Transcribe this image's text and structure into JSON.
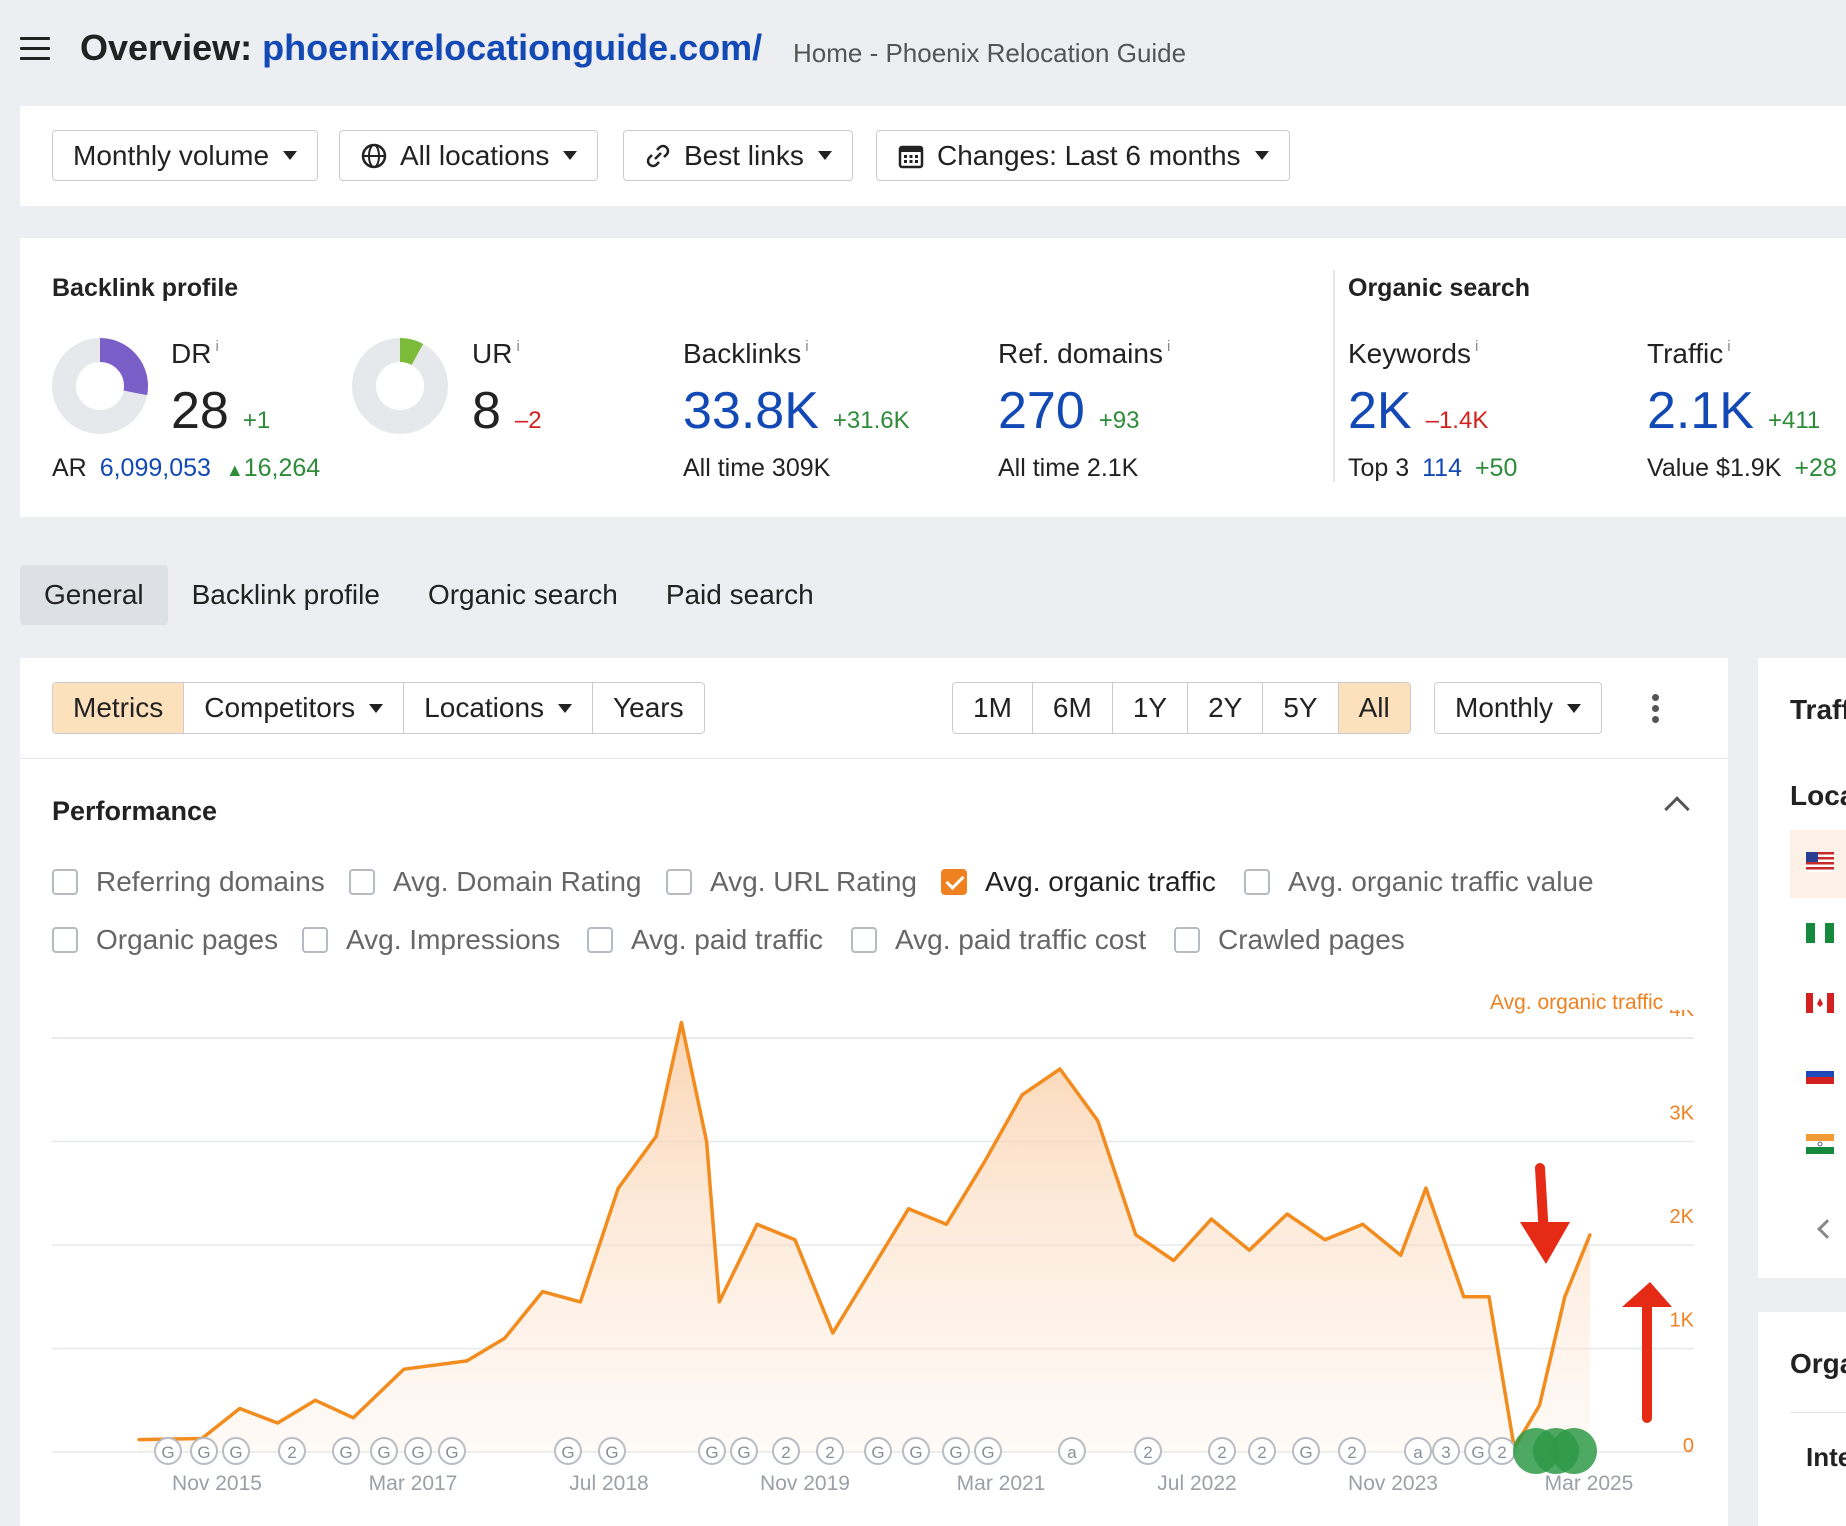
{
  "header": {
    "title_prefix": "Overview:",
    "domain": "phoenixrelocationguide.com/",
    "page_title": "Home - Phoenix Relocation Guide"
  },
  "toolbar": {
    "volume": "Monthly volume",
    "locations": "All locations",
    "links": "Best links",
    "changes": "Changes: Last 6 months"
  },
  "backlink_profile": {
    "title": "Backlink profile",
    "dr": {
      "label": "DR",
      "info": "i",
      "value": "28",
      "delta": "+1",
      "fill": 0.28,
      "color": "#7b5fc9"
    },
    "ur": {
      "label": "UR",
      "info": "i",
      "value": "8",
      "delta": "–2",
      "fill": 0.08,
      "color": "#7cbb39"
    },
    "ar": {
      "label": "AR",
      "value": "6,099,053",
      "delta": "16,264"
    },
    "backlinks": {
      "label": "Backlinks",
      "info": "i",
      "value": "33.8K",
      "delta": "+31.6K",
      "sub_label": "All time",
      "sub_value": "309K"
    },
    "ref_domains": {
      "label": "Ref. domains",
      "info": "i",
      "value": "270",
      "delta": "+93",
      "sub_label": "All time",
      "sub_value": "2.1K"
    }
  },
  "organic_search": {
    "title": "Organic search",
    "keywords": {
      "label": "Keywords",
      "info": "i",
      "value": "2K",
      "delta": "–1.4K",
      "sub_label": "Top 3",
      "sub_value": "114",
      "sub_delta": "+50"
    },
    "traffic": {
      "label": "Traffic",
      "info": "i",
      "value": "2.1K",
      "delta": "+411",
      "sub_label": "Value",
      "sub_value": "$1.9K",
      "sub_delta": "+28"
    }
  },
  "tabs": [
    "General",
    "Backlink profile",
    "Organic search",
    "Paid search"
  ],
  "controls": {
    "metrics": "Metrics",
    "competitors": "Competitors",
    "locations": "Locations",
    "years": "Years",
    "ranges": [
      "1M",
      "6M",
      "1Y",
      "2Y",
      "5Y",
      "All"
    ],
    "active_range": "All",
    "interval": "Monthly"
  },
  "performance": {
    "title": "Performance",
    "checkboxes_row1": [
      {
        "label": "Referring domains",
        "checked": false
      },
      {
        "label": "Avg. Domain Rating",
        "checked": false
      },
      {
        "label": "Avg. URL Rating",
        "checked": false
      },
      {
        "label": "Avg. organic traffic",
        "checked": true
      },
      {
        "label": "Avg. organic traffic value",
        "checked": false
      }
    ],
    "checkboxes_row2": [
      {
        "label": "Organic pages",
        "checked": false
      },
      {
        "label": "Avg. Impressions",
        "checked": false
      },
      {
        "label": "Avg. paid traffic",
        "checked": false
      },
      {
        "label": "Avg. paid traffic cost",
        "checked": false
      },
      {
        "label": "Crawled pages",
        "checked": false
      }
    ]
  },
  "chart_data": {
    "type": "area",
    "series": [
      {
        "name": "Avg. organic traffic",
        "color": "#f28c1e",
        "values": [
          {
            "x": "2015-08",
            "y": 120
          },
          {
            "x": "2016-01",
            "y": 130
          },
          {
            "x": "2016-04",
            "y": 420
          },
          {
            "x": "2016-07",
            "y": 280
          },
          {
            "x": "2016-10",
            "y": 500
          },
          {
            "x": "2017-01",
            "y": 330
          },
          {
            "x": "2017-05",
            "y": 800
          },
          {
            "x": "2017-10",
            "y": 880
          },
          {
            "x": "2018-01",
            "y": 1100
          },
          {
            "x": "2018-04",
            "y": 1550
          },
          {
            "x": "2018-07",
            "y": 1450
          },
          {
            "x": "2018-10",
            "y": 2550
          },
          {
            "x": "2019-01",
            "y": 3050
          },
          {
            "x": "2019-03",
            "y": 4150
          },
          {
            "x": "2019-05",
            "y": 3000
          },
          {
            "x": "2019-06",
            "y": 1450
          },
          {
            "x": "2019-09",
            "y": 2200
          },
          {
            "x": "2019-12",
            "y": 2050
          },
          {
            "x": "2020-03",
            "y": 1150
          },
          {
            "x": "2020-06",
            "y": 1750
          },
          {
            "x": "2020-09",
            "y": 2350
          },
          {
            "x": "2020-12",
            "y": 2200
          },
          {
            "x": "2021-03",
            "y": 2800
          },
          {
            "x": "2021-06",
            "y": 3450
          },
          {
            "x": "2021-09",
            "y": 3700
          },
          {
            "x": "2021-12",
            "y": 3200
          },
          {
            "x": "2022-03",
            "y": 2100
          },
          {
            "x": "2022-06",
            "y": 1850
          },
          {
            "x": "2022-09",
            "y": 2250
          },
          {
            "x": "2022-12",
            "y": 1950
          },
          {
            "x": "2023-03",
            "y": 2300
          },
          {
            "x": "2023-06",
            "y": 2050
          },
          {
            "x": "2023-09",
            "y": 2200
          },
          {
            "x": "2023-12",
            "y": 1900
          },
          {
            "x": "2024-02",
            "y": 2550
          },
          {
            "x": "2024-05",
            "y": 1500
          },
          {
            "x": "2024-07",
            "y": 1500
          },
          {
            "x": "2024-09",
            "y": 40
          },
          {
            "x": "2024-11",
            "y": 450
          },
          {
            "x": "2025-01",
            "y": 1500
          },
          {
            "x": "2025-03",
            "y": 2100
          }
        ]
      }
    ],
    "y_ticks": [
      "0",
      "1K",
      "2K",
      "3K",
      "4K"
    ],
    "x_ticks": [
      "Nov 2015",
      "Mar 2017",
      "Jul 2018",
      "Nov 2019",
      "Mar 2021",
      "Jul 2022",
      "Nov 2023",
      "Mar 2025"
    ],
    "ylim": [
      0,
      4000
    ],
    "grid": true,
    "annotation_markers": [
      "G",
      "G",
      "G",
      "2",
      "G",
      "G",
      "G",
      "G",
      "G",
      "G",
      "G",
      "G",
      "2",
      "2",
      "G",
      "G",
      "G",
      "G",
      "a",
      "2",
      "2",
      "2",
      "G",
      "2",
      "a",
      "3",
      "G",
      "2"
    ]
  },
  "side_panel": {
    "title1": "Traff",
    "locations_label": "Loca",
    "title2": "Orga",
    "item": "Inte"
  }
}
